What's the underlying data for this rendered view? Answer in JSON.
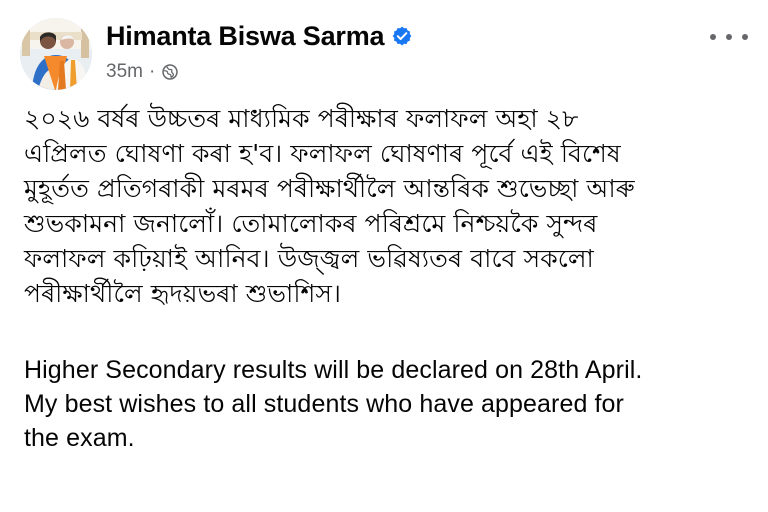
{
  "post": {
    "author": {
      "name": "Himanta Biswa Sarma",
      "verified_icon": "verified-badge-icon",
      "avatar_icon": "profile-photo"
    },
    "time": "35m",
    "separator": "·",
    "audience_icon": "globe-icon",
    "more_icon": "more-options-icon",
    "body": {
      "assamese_lines": [
        "২০২৬ বৰ্ষৰ উচ্চতৰ মাধ্যমিক পৰীক্ষাৰ ফলাফল অহা ২৮",
        "এপ্ৰিলত ঘোষণা কৰা হ'ব। ফলাফল ঘোষণাৰ  পূৰ্বে এই বিশেষ",
        "মুহূৰ্তত প্ৰতিগৰাকী মৰমৰ পৰীক্ষাৰ্থীলৈ আন্তৰিক শুভেচ্ছা আৰু",
        "শুভকামনা জনালোঁ। তোমালোকৰ পৰিশ্ৰমে নিশ্চয়কৈ সুন্দৰ",
        "ফলাফল কঢ়িয়াই আনিব। উজ্জ্বল ভৱিষ্যতৰ বাবে সকলো",
        "পৰীক্ষাৰ্থীলৈ হৃদয়ভৰা শুভাশিস।"
      ],
      "english_lines": [
        "Higher Secondary results will be declared on 28th April.",
        "My best wishes to all students who have appeared for",
        "the exam."
      ]
    }
  },
  "colors": {
    "text": "#050505",
    "secondary_text": "#65676b",
    "verified_blue": "#1877f2"
  }
}
